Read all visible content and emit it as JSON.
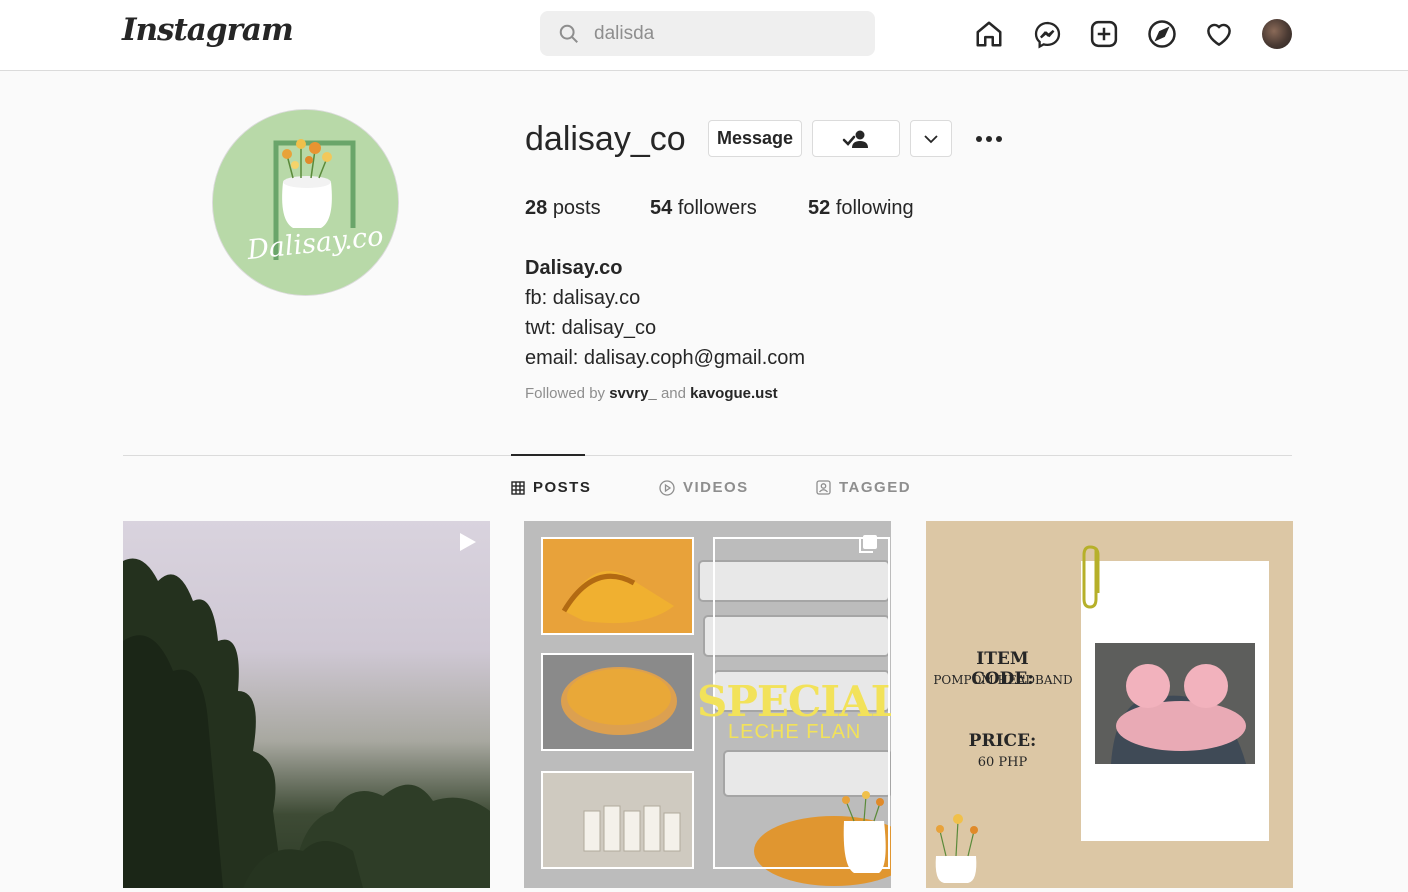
{
  "header": {
    "logo_text": "Instagram",
    "search_value": "dalisda",
    "nav_icons": [
      "home-icon",
      "messenger-icon",
      "new-post-icon",
      "explore-icon",
      "activity-heart-icon"
    ]
  },
  "profile": {
    "username": "dalisay_co",
    "message_label": "Message",
    "posts_count": "28",
    "posts_label": "posts",
    "followers_count": "54",
    "followers_label": "followers",
    "following_count": "52",
    "following_label": "following",
    "display_name": "Dalisay.co",
    "bio_lines": [
      "fb: dalisay.co",
      "twt: dalisay_co",
      "email: dalisay.coph@gmail.com"
    ],
    "followed_by_prefix": "Followed by",
    "followed_by_user1": "svvry_",
    "followed_by_and": "and",
    "followed_by_user2": "kavogue.ust",
    "avatar_text": "Dalisay.co"
  },
  "tabs": [
    {
      "label": "POSTS",
      "active": true
    },
    {
      "label": "VIDEOS",
      "active": false
    },
    {
      "label": "TAGGED",
      "active": false
    }
  ],
  "posts": {
    "post2": {
      "title": "SPECIAL",
      "subtitle": "LECHE FLAN"
    },
    "post3": {
      "code_label": "ITEM CODE:",
      "code_value": "POMPOM HEADBAND",
      "price_label": "PRICE:",
      "price_value": "60 PHP"
    }
  },
  "colors": {
    "accent": "#262626",
    "border": "#dbdbdb",
    "muted": "#8e8e8e",
    "avatar_bg": "#b8d9a8"
  }
}
